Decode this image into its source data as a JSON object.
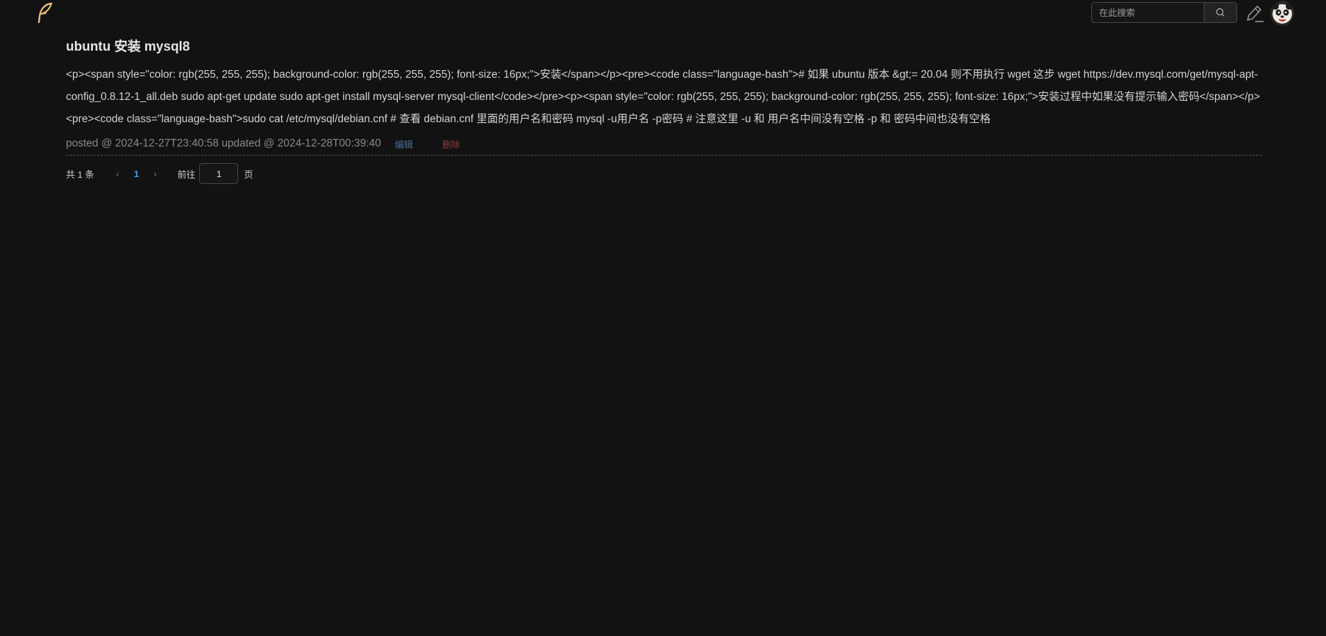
{
  "header": {
    "logo_icon": "feather-icon",
    "search": {
      "placeholder": "在此搜索",
      "value": ""
    },
    "search_icon": "search-icon",
    "write_icon": "pen-icon",
    "avatar_icon": "panda-avatar"
  },
  "post": {
    "title": "ubuntu 安装 mysql8",
    "body": "<p><span style=\"color: rgb(255, 255, 255); background-color: rgb(255, 255, 255); font-size: 16px;\">安装</span></p><pre><code class=\"language-bash\"># 如果 ubuntu 版本 &gt;= 20.04 则不用执行 wget 这步 wget https://dev.mysql.com/get/mysql-apt-config_0.8.12-1_all.deb sudo apt-get update sudo apt-get install mysql-server mysql-client</code></pre><p><span style=\"color: rgb(255, 255, 255); background-color: rgb(255, 255, 255); font-size: 16px;\">安装过程中如果没有提示输入密码</span></p><pre><code class=\"language-bash\">sudo cat /etc/mysql/debian.cnf # 查看 debian.cnf 里面的用户名和密码 mysql -u用户名 -p密码 # 注意这里 -u 和 用户名中间没有空格 -p 和 密码中间也没有空格",
    "meta": "posted @ 2024-12-27T23:40:58 updated @ 2024-12-28T00:39:40",
    "edit_label": "编辑",
    "delete_label": "删除"
  },
  "pagination": {
    "total_label": "共 1 条",
    "prev_icon": "chevron-left-icon",
    "current_page": "1",
    "next_icon": "chevron-right-icon",
    "goto_label": "前往",
    "goto_value": "1",
    "page_suffix": "页"
  },
  "colors": {
    "background": "#121212",
    "link_edit": "#4a6e96",
    "link_delete": "#8a3c3c",
    "page_active": "#409eff",
    "logo": "#e8c27a"
  }
}
